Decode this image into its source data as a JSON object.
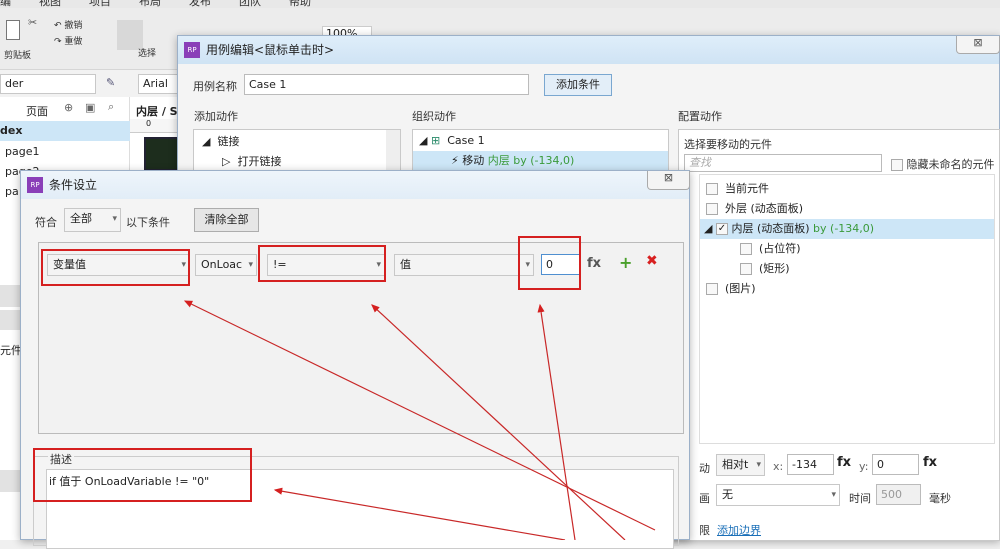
{
  "app": {
    "menu": [
      "编",
      "视图",
      "项目",
      "布局",
      "发布",
      "团队",
      "帮助"
    ],
    "toolbar": {
      "clipboard": "剪贴板",
      "undo": "撤销",
      "redo": "重做",
      "select": "选择",
      "zoom": "100%"
    },
    "style_select": "der",
    "font_select": "Arial",
    "pages": {
      "header": "页面",
      "items": [
        "dex",
        "page1",
        "page2",
        "pa"
      ]
    },
    "canvas_tab": "内层 / St",
    "ruler_zero": "0",
    "widgets_label": "元件"
  },
  "case_editor": {
    "title": "用例编辑<鼠标单击时>",
    "case_name_label": "用例名称",
    "case_name": "Case 1",
    "add_condition": "添加条件",
    "add_action_label": "添加动作",
    "organize_label": "组织动作",
    "configure_label": "配置动作",
    "actions_tree": {
      "group": "链接",
      "item": "打开链接"
    },
    "case_tree": {
      "case": "Case 1",
      "action_verb": "移动",
      "action_target": "内层 by (-134,0)"
    },
    "config": {
      "heading": "选择要移动的元件",
      "search_placeholder": "查找",
      "hide_unnamed": "隐藏未命名的元件",
      "widgets": [
        {
          "label": "当前元件",
          "extra": ""
        },
        {
          "label": "外层 (动态面板)",
          "extra": ""
        },
        {
          "label": "内层 (动态面板)",
          "extra": " by (-134,0)",
          "checked": true
        },
        {
          "label": "(占位符)",
          "extra": ""
        },
        {
          "label": "(矩形)",
          "extra": ""
        },
        {
          "label": "(图片)",
          "extra": ""
        }
      ],
      "move_label": "动",
      "move_mode": "相对t",
      "x_label": "x:",
      "x_value": "-134",
      "y_label": "y:",
      "y_value": "0",
      "fx": "fx",
      "anim_label": "画",
      "anim_value": "无",
      "time_label": "时间",
      "time_value": "500",
      "ms": "毫秒",
      "bounds_label": "限",
      "add_bounds": "添加边界"
    }
  },
  "condition_dialog": {
    "title": "条件设立",
    "match_label": "符合",
    "match_value": "全部",
    "following": "以下条件",
    "clear_all": "清除全部",
    "row": {
      "type": "变量值",
      "variable": "OnLoac",
      "operator": "!=",
      "value_type": "值",
      "value": "0",
      "fx": "fx"
    },
    "description_label": "描述",
    "description": "if 值于 OnLoadVariable != \"0\""
  }
}
